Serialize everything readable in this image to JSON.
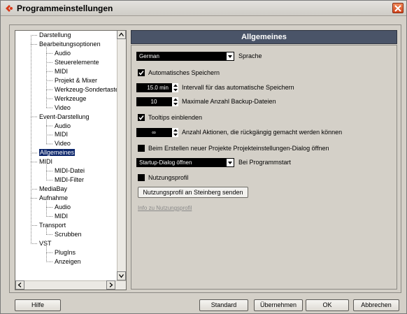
{
  "window": {
    "title": "Programmeinstellungen"
  },
  "tree": {
    "items": [
      {
        "label": "Darstellung",
        "level": 0
      },
      {
        "label": "Bearbeitungsoptionen",
        "level": 0
      },
      {
        "label": "Audio",
        "level": 1
      },
      {
        "label": "Steuerelemente",
        "level": 1
      },
      {
        "label": "MIDI",
        "level": 1
      },
      {
        "label": "Projekt & Mixer",
        "level": 1
      },
      {
        "label": "Werkzeug-Sondertaste",
        "level": 1
      },
      {
        "label": "Werkzeuge",
        "level": 1
      },
      {
        "label": "Video",
        "level": 1
      },
      {
        "label": "Event-Darstellung",
        "level": 0
      },
      {
        "label": "Audio",
        "level": 1
      },
      {
        "label": "MIDI",
        "level": 1
      },
      {
        "label": "Video",
        "level": 1
      },
      {
        "label": "Allgemeines",
        "level": 0,
        "selected": true
      },
      {
        "label": "MIDI",
        "level": 0
      },
      {
        "label": "MIDI-Datei",
        "level": 1
      },
      {
        "label": "MIDI-Filter",
        "level": 1
      },
      {
        "label": "MediaBay",
        "level": 0
      },
      {
        "label": "Aufnahme",
        "level": 0
      },
      {
        "label": "Audio",
        "level": 1
      },
      {
        "label": "MIDI",
        "level": 1
      },
      {
        "label": "Transport",
        "level": 0
      },
      {
        "label": "Scrubben",
        "level": 1
      },
      {
        "label": "VST",
        "level": 0
      },
      {
        "label": "PlugIns",
        "level": 1
      },
      {
        "label": "Anzeigen",
        "level": 1
      }
    ]
  },
  "panel": {
    "header": "Allgemeines",
    "language": {
      "value": "German",
      "label": "Sprache"
    },
    "autosave": {
      "checked": true,
      "label": "Automatisches Speichern"
    },
    "interval": {
      "value": "15.0 min",
      "label": "Intervall für das automatische Speichern"
    },
    "backups": {
      "value": "10",
      "label": "Maximale Anzahl Backup-Dateien"
    },
    "tooltips": {
      "checked": true,
      "label": "Tooltips einblenden"
    },
    "undo": {
      "value": "∞",
      "label": "Anzahl Aktionen, die rückgängig gemacht werden können"
    },
    "project_dialog": {
      "checked": false,
      "label": "Beim Erstellen neuer Projekte Projekteinstellungen-Dialog öffnen"
    },
    "startup": {
      "value": "Startup-Dialog öffnen",
      "label": "Bei Programmstart"
    },
    "usage_profile": {
      "checked": false,
      "label": "Nutzungsprofil"
    },
    "send_button": "Nutzungsprofil an Steinberg senden",
    "info_link": "Info zu Nutzungsprofil"
  },
  "footer": {
    "help": "Hilfe",
    "standard": "Standard",
    "apply": "Übernehmen",
    "ok": "OK",
    "cancel": "Abbrechen"
  },
  "colors": {
    "header_bg": "#4a5468",
    "selection": "#0a246a",
    "window_bg": "#d4d0c8"
  }
}
